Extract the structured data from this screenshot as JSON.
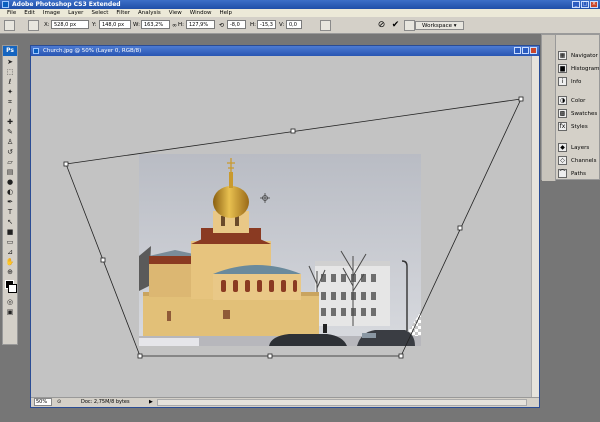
{
  "window": {
    "title": "Adobe Photoshop CS3 Extended"
  },
  "menu": [
    "File",
    "Edit",
    "Image",
    "Layer",
    "Select",
    "Filter",
    "Analysis",
    "View",
    "Window",
    "Help"
  ],
  "options": {
    "x_label": "X:",
    "x_value": "528,0 px",
    "y_label": "Y:",
    "y_value": "148,0 px",
    "w_label": "W:",
    "w_value": "163,2%",
    "h_label": "H:",
    "h_value": "127,9%",
    "rot_value": "-8,0",
    "hskew_label": "H:",
    "hskew_value": "-15,3",
    "vskew_label": "V:",
    "vskew_value": "0,0",
    "workspace": "Workspace"
  },
  "document": {
    "title": "Church.jpg @ 50% (Layer 0, RGB/8)",
    "zoom": "50%",
    "docsize": "Doc: 2,75M/8 bytes"
  },
  "panels": {
    "group1": [
      "Navigator",
      "Histogram",
      "Info"
    ],
    "group2": [
      "Color",
      "Swatches",
      "Styles"
    ],
    "group3": [
      "Layers",
      "Channels",
      "Paths"
    ]
  },
  "colors": {
    "titlebar": "#2354b0",
    "sky": "#c9ccd3",
    "church_wall": "#e2c078",
    "dome": "#c99a2e",
    "roof": "#6a8a9c",
    "brick": "#8a3a22"
  }
}
